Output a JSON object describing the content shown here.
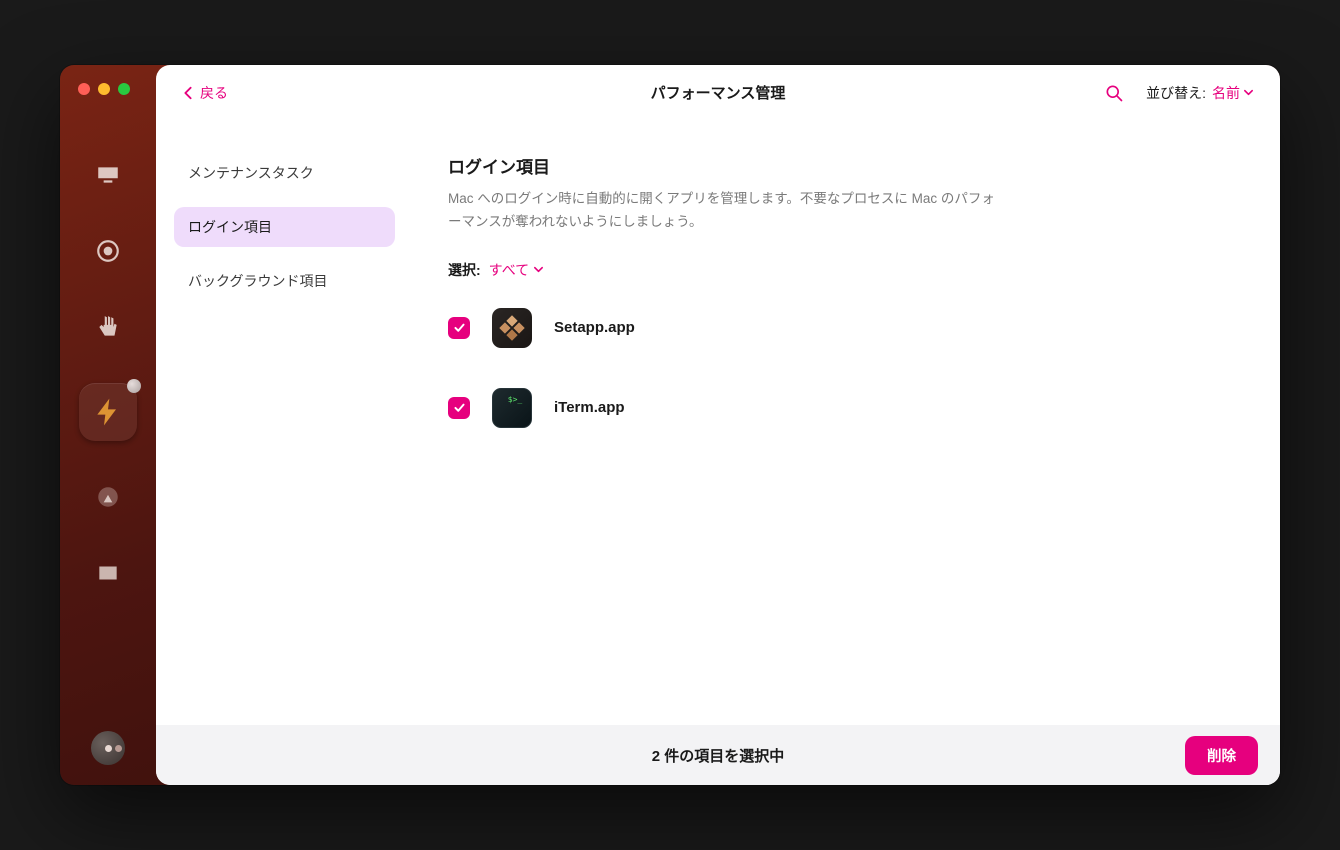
{
  "header": {
    "back_label": "戻る",
    "title": "パフォーマンス管理",
    "sort_label": "並び替え:",
    "sort_value": "名前"
  },
  "categories": {
    "items": [
      {
        "label": "メンテナンスタスク",
        "active": false
      },
      {
        "label": "ログイン項目",
        "active": true
      },
      {
        "label": "バックグラウンド項目",
        "active": false
      }
    ]
  },
  "content": {
    "title": "ログイン項目",
    "description": "Mac へのログイン時に自動的に開くアプリを管理します。不要なプロセスに Mac のパフォーマンスが奪われないようにしましょう。",
    "select_label": "選択:",
    "select_action": "すべて",
    "items": [
      {
        "name": "Setapp.app",
        "icon": "setapp",
        "checked": true
      },
      {
        "name": "iTerm.app",
        "icon": "iterm",
        "checked": true
      }
    ]
  },
  "footer": {
    "status": "2 件の項目を選択中",
    "delete_label": "削除"
  }
}
